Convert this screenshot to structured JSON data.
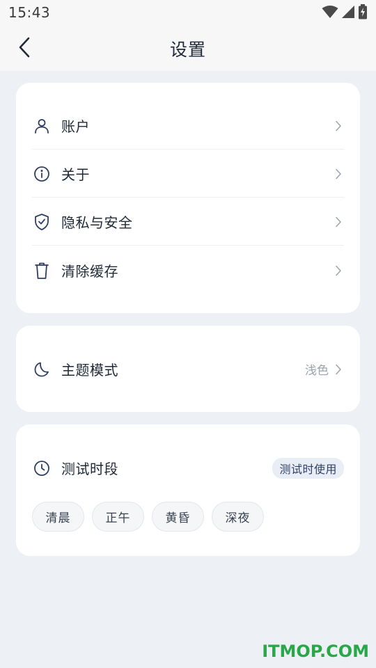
{
  "status_bar": {
    "time": "15:43",
    "icons": [
      "wifi-icon",
      "signal-icon",
      "battery-charging-icon"
    ]
  },
  "app_bar": {
    "title": "设置",
    "back_icon": "chevron-left-icon"
  },
  "settings_group_1": {
    "items": [
      {
        "label": "账户",
        "icon": "user-icon"
      },
      {
        "label": "关于",
        "icon": "info-icon"
      },
      {
        "label": "隐私与安全",
        "icon": "shield-check-icon"
      },
      {
        "label": "清除缓存",
        "icon": "trash-icon"
      }
    ]
  },
  "settings_group_2": {
    "theme": {
      "label": "主题模式",
      "icon": "moon-icon",
      "value": "浅色"
    }
  },
  "settings_group_3": {
    "time_period": {
      "label": "测试时段",
      "icon": "clock-icon",
      "badge": "测试时使用"
    },
    "chips": [
      "清晨",
      "正午",
      "黄昏",
      "深夜"
    ]
  },
  "watermark": "ITMOP.COM",
  "colors": {
    "background": "#edf0f5",
    "card": "#ffffff",
    "icon": "#2f3f66",
    "watermark": "#2aa748"
  }
}
